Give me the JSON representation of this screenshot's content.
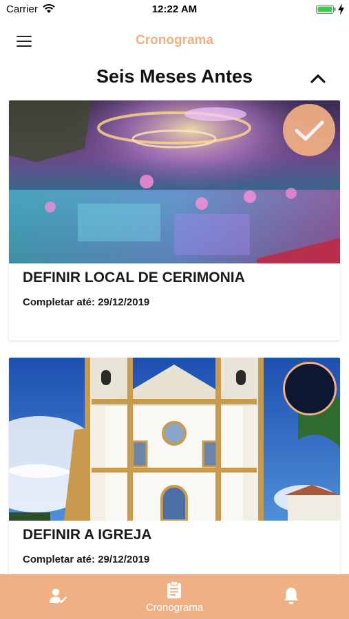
{
  "status_bar": {
    "carrier": "Carrier",
    "time": "12:22 AM"
  },
  "header": {
    "title": "Cronograma"
  },
  "section": {
    "title": "Seis Meses Antes"
  },
  "cards": [
    {
      "title": "DEFINIR LOCAL DE CERIMONIA",
      "due": "Completar até: 29/12/2019",
      "completed": true
    },
    {
      "title": "DEFINIR A IGREJA",
      "due": "Completar até: 29/12/2019",
      "completed": false
    }
  ],
  "tab_bar": {
    "tabs": [
      {
        "icon": "user-check-icon",
        "label": ""
      },
      {
        "icon": "clipboard-icon",
        "label": "Cronograma"
      },
      {
        "icon": "bell-icon",
        "label": ""
      }
    ]
  },
  "colors": {
    "accent": "#f0b083",
    "dark": "#0d1830"
  }
}
